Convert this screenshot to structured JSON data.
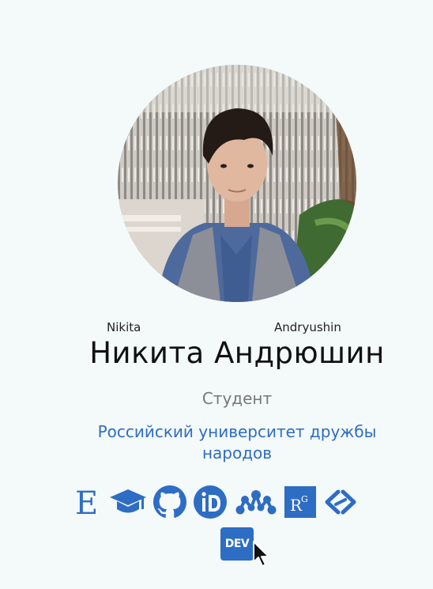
{
  "profile": {
    "given_name_latin": "Nikita",
    "family_name_latin": "Andryushin",
    "full_name": "Никита Андрюшин",
    "role": "Студент",
    "organization": "Российский университет дружбы народов"
  },
  "links": [
    {
      "icon": "elibrary-icon"
    },
    {
      "icon": "graduation-cap-icon"
    },
    {
      "icon": "github-icon"
    },
    {
      "icon": "orcid-icon"
    },
    {
      "icon": "mendeley-icon"
    },
    {
      "icon": "researchgate-icon"
    },
    {
      "icon": "link-icon"
    },
    {
      "icon": "dev-icon",
      "label": "DEV"
    }
  ],
  "colors": {
    "accent": "#2d6dc4",
    "background": "#f4f9f9",
    "muted_text": "#777777"
  }
}
